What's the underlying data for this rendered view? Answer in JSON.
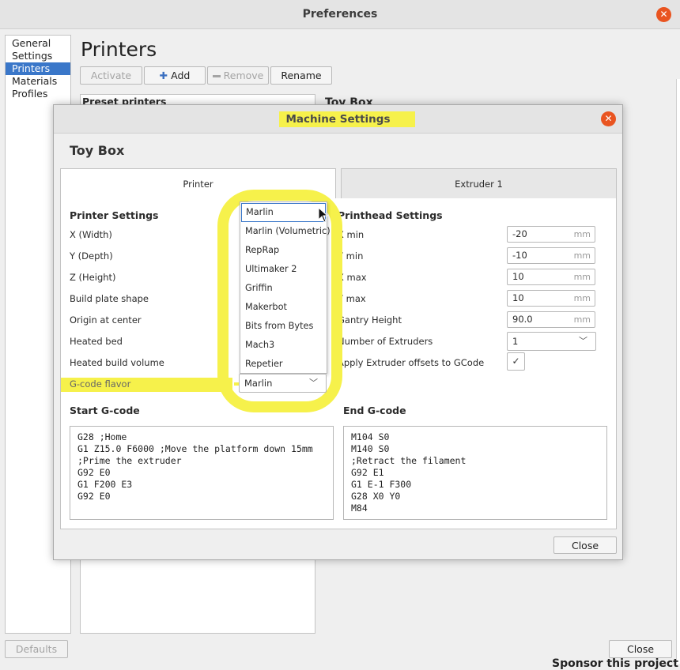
{
  "preferences": {
    "title": "Preferences",
    "sidebar": [
      "General",
      "Settings",
      "Printers",
      "Materials",
      "Profiles"
    ],
    "page_title": "Printers",
    "buttons": {
      "activate": "Activate",
      "add": "Add",
      "remove": "Remove",
      "rename": "Rename"
    },
    "preset_label": "Preset printers",
    "bg_printer_name": "Toy Box",
    "defaults": "Defaults",
    "close": "Close",
    "sponsor": "Sponsor this project"
  },
  "dialog": {
    "title": "Machine Settings",
    "heading": "Toy Box",
    "tabs": [
      "Printer",
      "Extruder 1"
    ],
    "printer_settings": {
      "title": "Printer Settings",
      "labels": [
        "X (Width)",
        "Y (Depth)",
        "Z (Height)",
        "Build plate shape",
        "Origin at center",
        "Heated bed",
        "Heated build volume",
        "G-code flavor"
      ]
    },
    "printhead_settings": {
      "title": "Printhead Settings",
      "fields": [
        {
          "label": "X min",
          "value": "-20",
          "unit": "mm"
        },
        {
          "label": "Y min",
          "value": "-10",
          "unit": "mm"
        },
        {
          "label": "X max",
          "value": "10",
          "unit": "mm"
        },
        {
          "label": "Y max",
          "value": "10",
          "unit": "mm"
        },
        {
          "label": "Gantry Height",
          "value": "90.0",
          "unit": "mm"
        }
      ],
      "extruders_label": "Number of Extruders",
      "extruders_value": "1",
      "apply_offsets_label": "Apply Extruder offsets to GCode",
      "apply_offsets_check": "✓"
    },
    "gcode_flavor": {
      "selected": "Marlin",
      "options": [
        "Marlin",
        "Marlin (Volumetric)",
        "RepRap",
        "Ultimaker 2",
        "Griffin",
        "Makerbot",
        "Bits from Bytes",
        "Mach3",
        "Repetier"
      ]
    },
    "start_gcode": {
      "title": "Start G-code",
      "text": "G28 ;Home\nG1 Z15.0 F6000 ;Move the platform down 15mm\n;Prime the extruder\nG92 E0\nG1 F200 E3\nG92 E0"
    },
    "end_gcode": {
      "title": "End G-code",
      "text": "M104 S0\nM140 S0\n;Retract the filament\nG92 E1\nG1 E-1 F300\nG28 X0 Y0\nM84"
    },
    "close": "Close"
  },
  "colors": {
    "accent": "#3a77c9",
    "close_icon": "#e95420",
    "highlight": "#f6f14b"
  }
}
